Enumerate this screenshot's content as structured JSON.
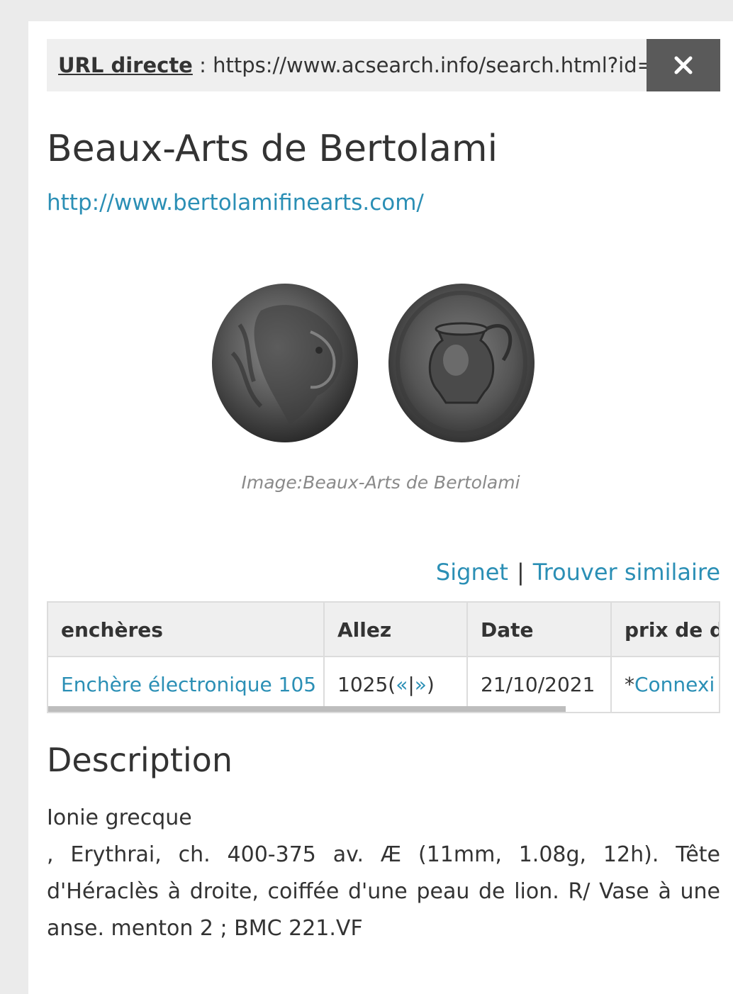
{
  "urlbar": {
    "label": "URL directe",
    "separator": " : ",
    "value": "https://www.acsearch.info/search.html?id="
  },
  "close_icon": "close-icon",
  "auction_house": {
    "name": "Beaux-Arts de Bertolami",
    "url": "http://www.bertolamifinearts.com/"
  },
  "image": {
    "caption": "Image:Beaux-Arts de Bertolami"
  },
  "actions": {
    "bookmark": "Signet",
    "separator": "|",
    "find_similar": "Trouver similaire"
  },
  "table": {
    "headers": [
      "enchères",
      "Allez",
      "Date",
      "prix de dé"
    ],
    "row": {
      "auction": "Enchère électronique 105",
      "lot_number": "1025",
      "nav_open": " ( ",
      "prev": "«",
      "nav_sep": " | ",
      "next": "»",
      "nav_close": " )",
      "date": "21/10/2021",
      "price_prefix": "* ",
      "price_link": "Connexi"
    }
  },
  "description": {
    "heading": "Description",
    "line1": "Ionie grecque",
    "body": ", Erythrai, ch. 400-375 av. Æ (11mm, 1.08g, 12h). Tête d'Héraclès à droite, coiffée d'une peau de lion. R/ Vase à une anse. menton 2 ; BMC 221.VF"
  },
  "colors": {
    "link": "#2b8fb5",
    "close_bg": "#5a5a5a",
    "bar_bg": "#efefef"
  }
}
